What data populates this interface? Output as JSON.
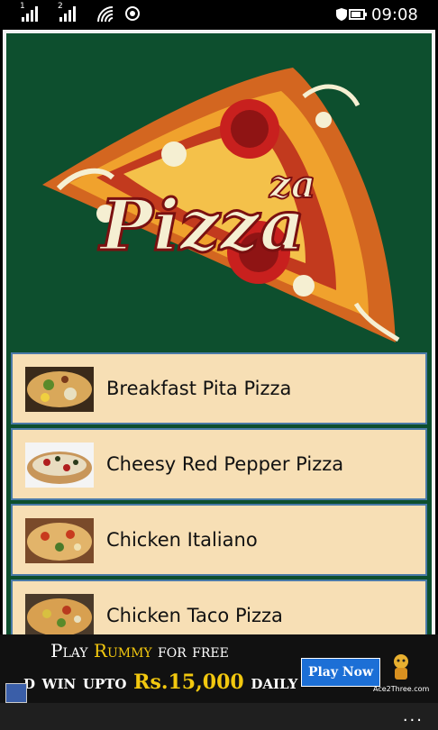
{
  "status_bar": {
    "sim1": "1",
    "sim2": "2",
    "time": "09:08",
    "battery_level": 0.8
  },
  "hero": {
    "logo_text_main": "Pizza",
    "logo_text_secondary": "za"
  },
  "recipes": [
    {
      "title": "Breakfast Pita Pizza",
      "thumbnail": "pizza-thumbnail-icon"
    },
    {
      "title": "Cheesy Red Pepper Pizza",
      "thumbnail": "pizza-thumbnail-icon"
    },
    {
      "title": "Chicken Italiano",
      "thumbnail": "pizza-thumbnail-icon"
    },
    {
      "title": "Chicken Taco Pizza",
      "thumbnail": "pizza-thumbnail-icon"
    }
  ],
  "ad": {
    "line1_part1": "Play ",
    "line1_highlight": "Rummy",
    "line1_part2": " for free",
    "line2_part1": "d win upto ",
    "line2_highlight": "Rs.15,000",
    "line2_part2": " daily",
    "button": "Play Now",
    "brand": "Ace2Three.com"
  },
  "app_bar": {
    "more": "..."
  },
  "colors": {
    "header_green": "#0d4f2e",
    "item_background": "#f7dfb5",
    "item_border": "#4a7aa8",
    "ad_highlight": "#f2c80f",
    "ad_button": "#1c6fd6"
  }
}
